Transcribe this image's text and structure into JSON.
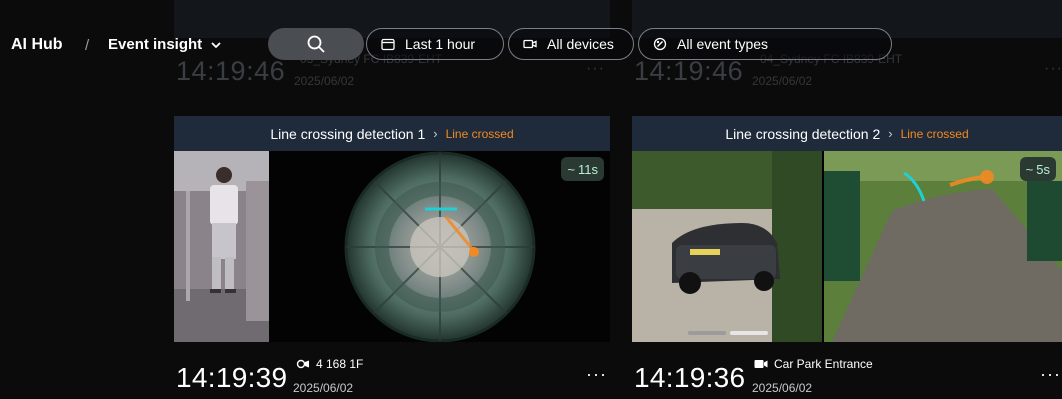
{
  "app": {
    "brand": "AI Hub",
    "separator": "/",
    "breadcrumb": "Event insight"
  },
  "filters": {
    "time_range": "Last 1 hour",
    "devices": "All devices",
    "event_types": "All event types"
  },
  "background_row": [
    {
      "time": "14:19:46",
      "device": "03_Sydney FC IB839-EHT",
      "date": "2025/06/02",
      "more": "···"
    },
    {
      "time": "14:19:46",
      "device": "04_Sydney FC IB839-EHT",
      "date": "2025/06/02",
      "more": "···"
    }
  ],
  "cards": [
    {
      "title": "Line crossing detection 1",
      "arrow": "›",
      "status": "Line crossed",
      "duration": "11s",
      "duration_icon": "trend-icon",
      "time": "14:19:39",
      "device": "4 168 1F",
      "device_icon": "fisheye-camera-icon",
      "date": "2025/06/02",
      "more": "···"
    },
    {
      "title": "Line crossing detection 2",
      "arrow": "›",
      "status": "Line crossed",
      "duration": "5s",
      "duration_icon": "trend-icon",
      "time": "14:19:36",
      "device": "Car Park Entrance",
      "device_icon": "video-camera-icon",
      "date": "2025/06/02",
      "more": "···"
    }
  ],
  "colors": {
    "status_orange": "#f08a24",
    "card_header": "#1f2b3a",
    "line_cyan": "#1fd1d6",
    "search_bg": "#4a4d52"
  }
}
